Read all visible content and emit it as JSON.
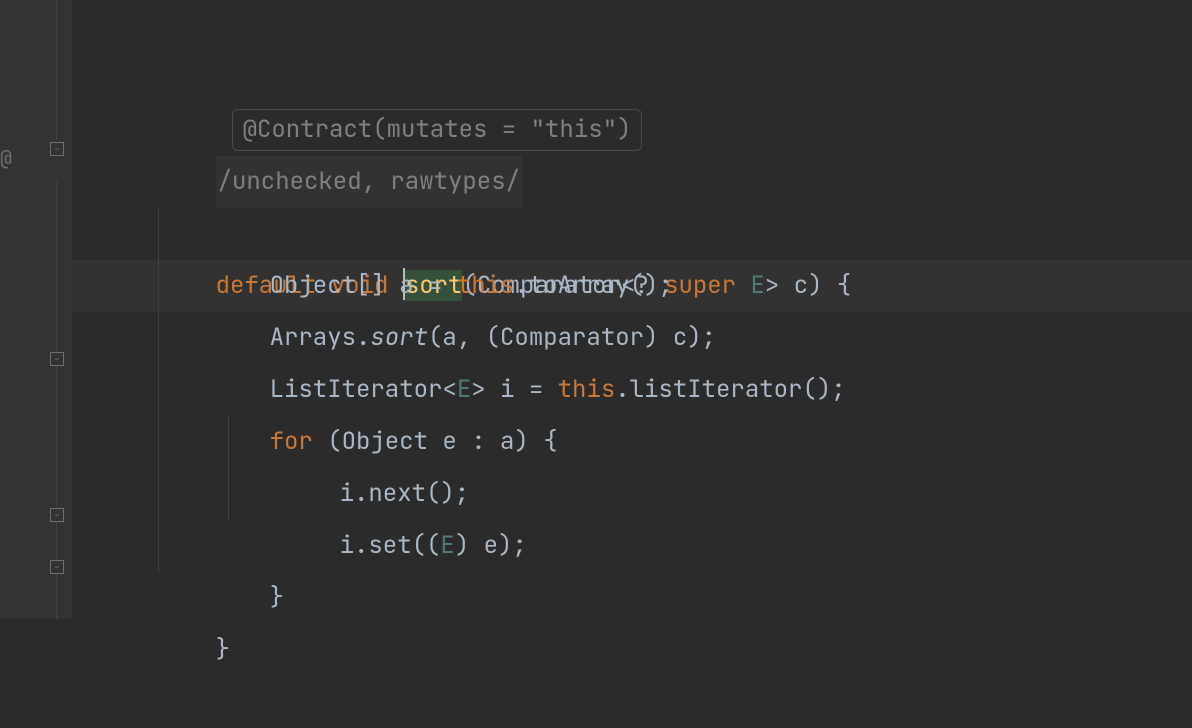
{
  "annotation": {
    "text": "@Contract(mutates = \"this\")"
  },
  "suppress": {
    "text": "/unchecked, rawtypes/"
  },
  "code": {
    "kw_default": "default",
    "kw_void": "void",
    "method_name": "sort",
    "sig_open": "(Comparator<",
    "sig_wild": "?",
    "kw_super": "super",
    "sig_generic": "E",
    "sig_close": "> c) {",
    "line2_a": "Object[] a = ",
    "kw_this": "this",
    "line2_b": ".toArray();",
    "line3_a": "Arrays.",
    "line3_sort": "sort",
    "line3_b": "(a, (Comparator) c);",
    "line4_a": "ListIterator<",
    "line4_gen": "E",
    "line4_b": "> i = ",
    "line4_c": ".listIterator();",
    "kw_for": "for",
    "line5_a": " (Object e : a) {",
    "line6": "i.next();",
    "line7_a": "i.set((",
    "line7_gen": "E",
    "line7_b": ") e);",
    "brace_close": "}",
    "brace_close2": "}"
  }
}
